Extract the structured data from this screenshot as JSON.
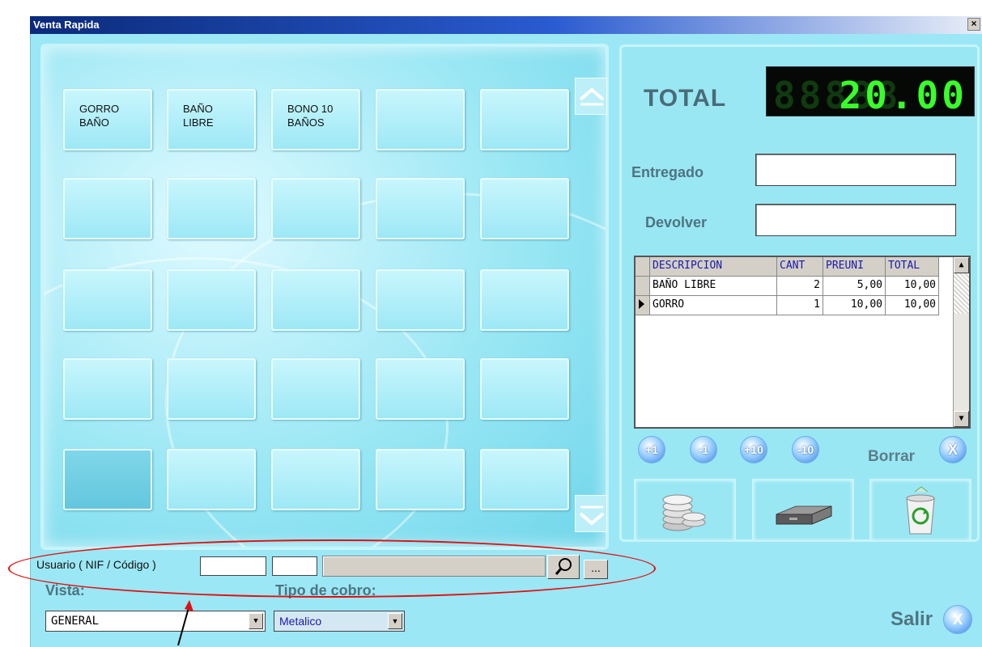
{
  "window": {
    "title": "Venta Rapida",
    "close": "×"
  },
  "tiles": [
    {
      "label": "GORRO\nBAÑO"
    },
    {
      "label": "BAÑO\nLIBRE"
    },
    {
      "label": "BONO 10\nBAÑOS"
    },
    {
      "label": ""
    },
    {
      "label": ""
    },
    {
      "label": ""
    },
    {
      "label": ""
    },
    {
      "label": ""
    },
    {
      "label": ""
    },
    {
      "label": ""
    },
    {
      "label": ""
    },
    {
      "label": ""
    },
    {
      "label": ""
    },
    {
      "label": ""
    },
    {
      "label": ""
    },
    {
      "label": ""
    },
    {
      "label": ""
    },
    {
      "label": ""
    },
    {
      "label": ""
    },
    {
      "label": ""
    },
    {
      "label": ""
    },
    {
      "label": ""
    },
    {
      "label": ""
    },
    {
      "label": ""
    },
    {
      "label": ""
    }
  ],
  "total": {
    "label": "TOTAL",
    "value": "20.00",
    "ghost": "88888"
  },
  "entregado": {
    "label": "Entregado",
    "value": ""
  },
  "devolver": {
    "label": "Devolver",
    "value": ""
  },
  "table": {
    "columns": [
      "DESCRIPCION",
      "CANT",
      "PREUNI",
      "TOTAL"
    ],
    "rows": [
      {
        "desc": "BAÑO LIBRE",
        "cant": "2",
        "preuni": "5,00",
        "total": "10,00"
      },
      {
        "desc": "GORRO",
        "cant": "1",
        "preuni": "10,00",
        "total": "10,00"
      }
    ]
  },
  "qty_buttons": [
    "+1",
    "-1",
    "+10",
    "-10"
  ],
  "borrar": {
    "label": "Borrar",
    "btn": "X"
  },
  "usuario": {
    "label": "Usuario ( NIF / Código )",
    "search": "⚲",
    "more": "..."
  },
  "vista": {
    "label": "Vista:",
    "value": "GENERAL"
  },
  "tipo_cobro": {
    "label": "Tipo de cobro:",
    "value": "Metalico"
  },
  "salir": {
    "label": "Salir",
    "btn": "X"
  }
}
